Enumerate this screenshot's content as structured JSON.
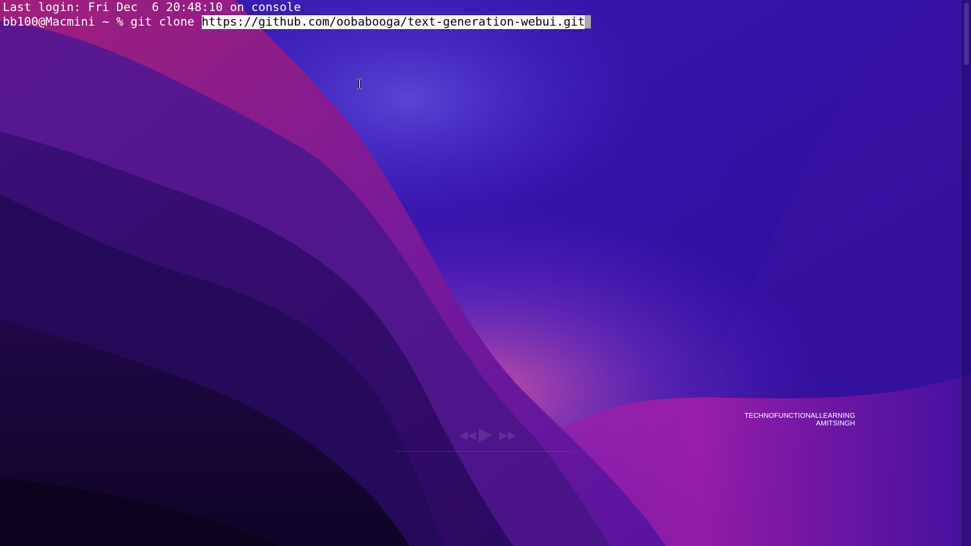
{
  "terminal": {
    "last_login": "Last login: Fri Dec  6 20:48:10 on console",
    "prompt": "bb100@Macmini ~ % ",
    "command": "git clone ",
    "selected_url": "https://github.com/oobabooga/text-generation-webui.git"
  },
  "watermark": {
    "line1": "TECHNOFUNCTIONALLEARNING",
    "line2": "AMITSINGH"
  },
  "colors": {
    "terminal_text": "#ffffff",
    "selection_bg": "#ffffff",
    "selection_text": "#000000",
    "cursor": "#a8a8a8",
    "wallpaper_top": "#2b0fa0",
    "wallpaper_pink": "#c0208f",
    "wallpaper_dark": "#12052e"
  },
  "icons": [
    "ibeam-cursor-icon",
    "rewind-icon",
    "play-icon",
    "fast-forward-icon"
  ]
}
